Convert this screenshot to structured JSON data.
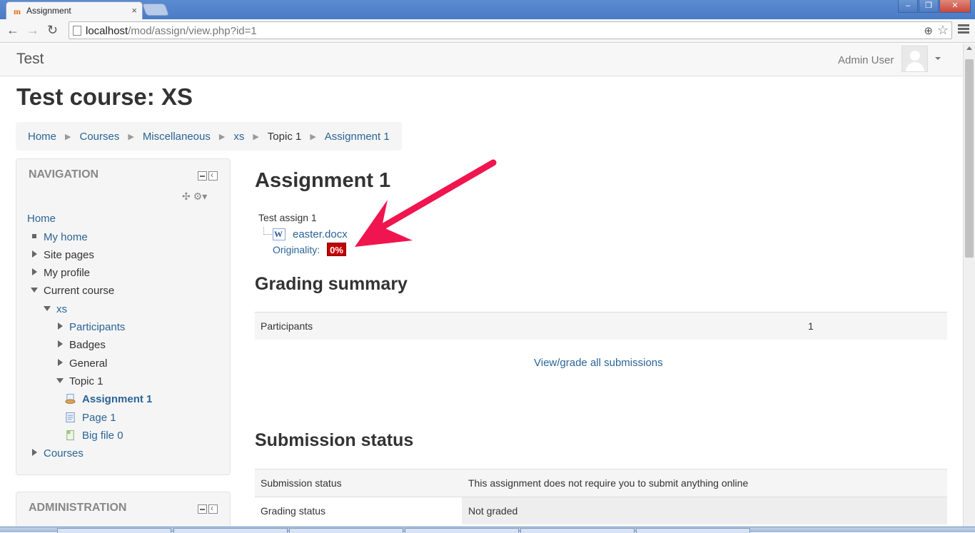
{
  "browser": {
    "tab_title": "Assignment",
    "tab_favicon": "m",
    "tab_close": "×",
    "url_host": "localhost",
    "url_path": "/mod/assign/view.php?id=1",
    "window_controls": {
      "minimize": "–",
      "restore": "❐",
      "close": "✕"
    }
  },
  "navbar": {
    "brand": "Test",
    "user_name": "Admin User"
  },
  "page": {
    "course_title": "Test course: XS"
  },
  "breadcrumb": [
    "Home",
    "Courses",
    "Miscellaneous",
    "xs",
    "Topic 1",
    "Assignment 1"
  ],
  "navigation": {
    "title": "NAVIGATION",
    "items": {
      "home": "Home",
      "my_home": "My home",
      "site_pages": "Site pages",
      "my_profile": "My profile",
      "current_course": "Current course",
      "xs": "xs",
      "participants": "Participants",
      "badges": "Badges",
      "general": "General",
      "topic1": "Topic 1",
      "assignment1": "Assignment 1",
      "page1": "Page 1",
      "bigfile0": "Big file 0",
      "courses": "Courses"
    }
  },
  "administration": {
    "title": "ADMINISTRATION"
  },
  "assignment": {
    "title": "Assignment 1",
    "intro": "Test assign 1",
    "file_name": "easter.docx",
    "originality_label": "Originality:",
    "originality_score": "0%"
  },
  "grading_summary": {
    "heading": "Grading summary",
    "rows": [
      {
        "label": "Participants",
        "value": "1"
      }
    ],
    "view_all": "View/grade all submissions"
  },
  "submission_status": {
    "heading": "Submission status",
    "rows": [
      {
        "label": "Submission status",
        "value": "This assignment does not require you to submit anything online"
      },
      {
        "label": "Grading status",
        "value": "Not graded"
      }
    ]
  },
  "colors": {
    "link": "#2a6496",
    "originality_badge": "#c40000",
    "annotation_arrow": "#f0154f"
  }
}
